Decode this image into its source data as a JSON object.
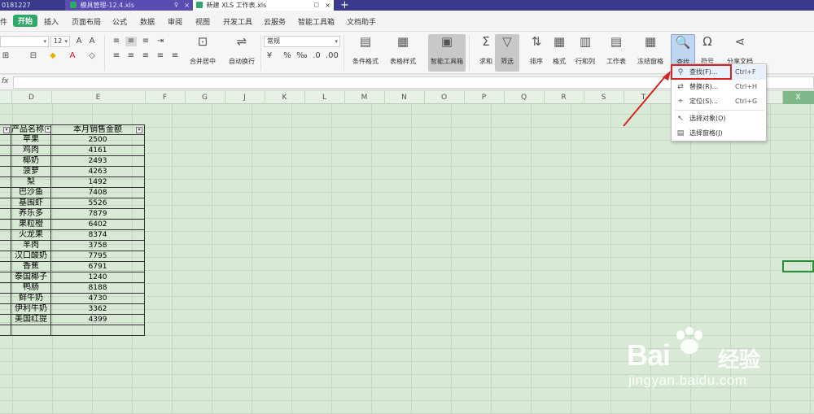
{
  "tabs": [
    {
      "label": "0181227"
    },
    {
      "label": "模具管理-12.4.xls"
    },
    {
      "label": "新建 XLS 工作表.xls"
    }
  ],
  "menu": {
    "left_glyph": "件",
    "items": [
      "开始",
      "插入",
      "页面布局",
      "公式",
      "数据",
      "审阅",
      "视图",
      "开发工具",
      "云服务",
      "智能工具箱",
      "文档助手"
    ]
  },
  "ribbon": {
    "font_size": "12",
    "number_format": "常规",
    "labels": {
      "merge": "合并居中",
      "wrap": "自动换行",
      "cond_format": "条件格式",
      "table_style": "表格样式",
      "smart_toolbox": "智能工具箱",
      "sum": "求和",
      "filter": "筛选",
      "sort": "排序",
      "format": "格式",
      "rows_cols": "行和列",
      "worksheet": "工作表",
      "freeze": "冻结窗格",
      "find": "查找",
      "symbol": "符号",
      "share": "分享文档"
    }
  },
  "formula_bar": {
    "fx": "fx",
    "value": ""
  },
  "columns": [
    "D",
    "E",
    "F",
    "G",
    "J",
    "K",
    "L",
    "M",
    "N",
    "O",
    "P",
    "Q",
    "R",
    "S",
    "T",
    "X"
  ],
  "table": {
    "headers": [
      "产品名称",
      "本月销售金额"
    ],
    "rows": [
      {
        "name": "苹果",
        "amount": "2500"
      },
      {
        "name": "鸡肉",
        "amount": "4161"
      },
      {
        "name": "椰奶",
        "amount": "2493"
      },
      {
        "name": "菠萝",
        "amount": "4263"
      },
      {
        "name": "梨",
        "amount": "1492"
      },
      {
        "name": "巴沙鱼",
        "amount": "7408"
      },
      {
        "name": "基围虾",
        "amount": "5526"
      },
      {
        "name": "养乐多",
        "amount": "7879"
      },
      {
        "name": "果粒橙",
        "amount": "6402"
      },
      {
        "name": "火龙果",
        "amount": "8374"
      },
      {
        "name": "羊肉",
        "amount": "3758"
      },
      {
        "name": "汉口酸奶",
        "amount": "7795"
      },
      {
        "name": "香蕉",
        "amount": "6791"
      },
      {
        "name": "泰国椰子",
        "amount": "1240"
      },
      {
        "name": "鸭肠",
        "amount": "8188"
      },
      {
        "name": "鲜牛奶",
        "amount": "4730"
      },
      {
        "name": "伊利牛奶",
        "amount": "3362"
      },
      {
        "name": "美国红提",
        "amount": "4399"
      }
    ]
  },
  "dropdown": {
    "items": [
      {
        "label": "查找(F)...",
        "shortcut": "Ctrl+F",
        "icon": "search-icon"
      },
      {
        "label": "替换(R)...",
        "shortcut": "Ctrl+H",
        "icon": "replace-icon"
      },
      {
        "label": "定位(S)...",
        "shortcut": "Ctrl+G",
        "icon": "goto-icon"
      },
      {
        "label": "选择对象(O)",
        "shortcut": "",
        "icon": "select-object-icon"
      },
      {
        "label": "选择窗格(J)",
        "shortcut": "",
        "icon": "selection-pane-icon"
      }
    ]
  },
  "watermark": {
    "brand": "Bai",
    "brand_suffix": "经验",
    "url": "jingyan.baidu.com"
  },
  "colors": {
    "accent_green": "#2fa86a",
    "grid_bg": "#d8ead5",
    "highlight_red": "#d42424"
  }
}
